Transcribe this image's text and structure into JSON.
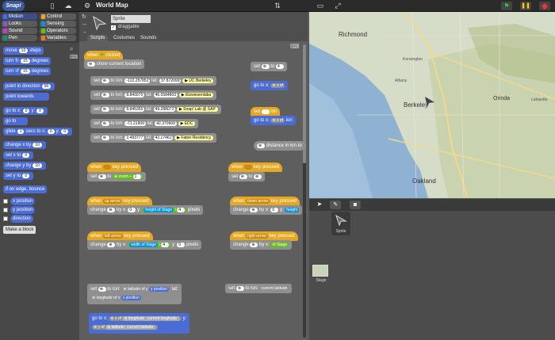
{
  "title": "World Map",
  "sprite": {
    "name": "Sprite",
    "draggable": "draggable"
  },
  "tabs": [
    "Scripts",
    "Costumes",
    "Sounds"
  ],
  "categories": [
    {
      "label": "Motion",
      "color": "#4a6cd4"
    },
    {
      "label": "Control",
      "color": "#e6a822"
    },
    {
      "label": "Looks",
      "color": "#8a55d7"
    },
    {
      "label": "Sensing",
      "color": "#0494dc"
    },
    {
      "label": "Sound",
      "color": "#bb42c3"
    },
    {
      "label": "Operators",
      "color": "#62c213"
    },
    {
      "label": "Pen",
      "color": "#009870"
    },
    {
      "label": "Variables",
      "color": "#f3761d"
    }
  ],
  "palette": {
    "move": "move",
    "move_n": "10",
    "steps": "steps",
    "turn": "turn",
    "turn_n1": "15",
    "degrees": "degrees",
    "turn_n2": "15",
    "point_dir": "point in direction",
    "point_dir_v": "90",
    "point_towards": "point towards",
    "goto": "go to x:",
    "goto_x": "0",
    "goto_y_lbl": "y:",
    "goto_y": "0",
    "go_to": "go to",
    "glide": "glide",
    "glide_n": "1",
    "glide_mid": "secs to x:",
    "glide_x": "0",
    "glide_y_lbl": "y:",
    "glide_y": "0",
    "change_x": "change x by",
    "change_x_n": "10",
    "set_x": "set x to",
    "set_x_n": "0",
    "change_y": "change y by",
    "change_y_n": "10",
    "set_y": "set y to",
    "set_y_n": "0",
    "bounce": "if on edge, bounce",
    "xpos": "x position",
    "ypos": "y position",
    "direction": "direction",
    "make_block": "Make a block"
  },
  "scripts": {
    "when_clicked": "when",
    "clicked": "clicked",
    "show_location": "show current location",
    "rows": [
      {
        "lon": "-122.257852",
        "lat": "37.872099",
        "label": "UC Berkeley"
      },
      {
        "lon": "8.843075",
        "lat": "46.5584803",
        "label": "Etzwiesenlaba"
      },
      {
        "lon": "8.845355",
        "lat": "49.288072",
        "label": "Snap! Lab @ SAP"
      },
      {
        "lon": "-71.21909",
        "lat": "42.370609",
        "label": "EDC"
      },
      {
        "lon": "2.493777",
        "lat": "42.17461",
        "label": "Faber Residency"
      }
    ],
    "set": "set",
    "to_lon": "to lon:",
    "lat_lbl": "lat:",
    "set_zoom": "set",
    "zoom_to": "to",
    "zoom_v": "4",
    "goto_x": "go to x:",
    "x_of": "x of",
    "lon": "lon",
    "show_lbl": "lon",
    "dist": "distance in km to",
    "when": "when",
    "key_pressed": "key pressed",
    "up_arrow": "up arrow",
    "down_arrow": "down arrow",
    "left_arrow": "left arrow",
    "right_arrow": "right arrow",
    "zoom": "zoom",
    "plus": "+",
    "one": "1",
    "change": "change",
    "by_x": "by x:",
    "by_y": "y:",
    "zero": "0",
    "height_of": "height",
    "of": "of",
    "stage": "Stage",
    "div": "/",
    "four": "4",
    "pixels": "pixels",
    "width_of": "width",
    "latitude_of_y": "latitude of y",
    "y_position": "y position",
    "longitude_of_x": "longitude of x",
    "x_position": "x position",
    "current_latitude": "current latitude",
    "current_longitude": "current longitude",
    "longitude": "longitude",
    "latitude": "latitude",
    "y_of": "y of"
  },
  "map": {
    "places": [
      "Richmond",
      "Berkeley",
      "Orinda",
      "Oakland",
      "Kensington",
      "Albany",
      "Lafayette"
    ]
  },
  "corral": {
    "sprite": "Sprite",
    "stage": "Stage"
  }
}
